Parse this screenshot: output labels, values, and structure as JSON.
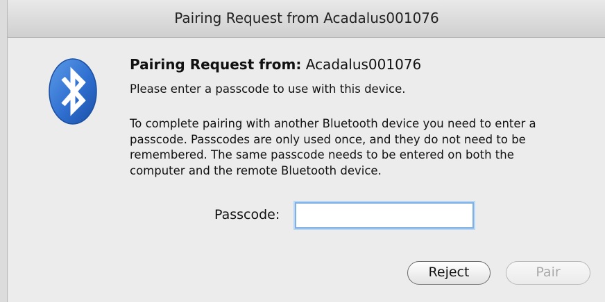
{
  "window": {
    "title": "Pairing Request from Acadalus001076"
  },
  "dialog": {
    "heading_label": "Pairing Request from:",
    "device_name": "Acadalus001076",
    "subtext": "Please enter a passcode to use with this device.",
    "body_lines": [
      "To complete pairing with another Bluetooth device you need to enter a",
      "passcode. Passcodes are only used once, and they do not need to be",
      "remembered. The same passcode needs to be entered on both the",
      "computer and the remote Bluetooth device."
    ],
    "icon": "bluetooth-icon"
  },
  "passcode": {
    "label": "Passcode:",
    "value": ""
  },
  "buttons": {
    "reject": "Reject",
    "pair": "Pair"
  },
  "colors": {
    "bluetooth_blue": "#2f6fd0",
    "focus_ring": "#7fb0e4",
    "disabled_text": "#a8a8a8"
  }
}
